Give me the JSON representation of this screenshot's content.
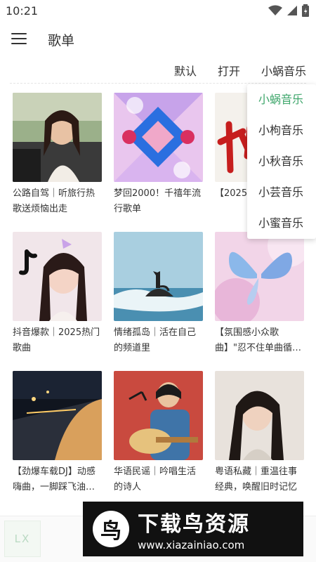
{
  "status": {
    "time": "10:21"
  },
  "app": {
    "title": "歌单"
  },
  "sources": [
    "默认",
    "打开",
    "小蜗音乐"
  ],
  "dropdown": {
    "items": [
      "小蜗音乐",
      "小枸音乐",
      "小秋音乐",
      "小芸音乐",
      "小蜜音乐"
    ],
    "selected_index": 0,
    "accent_color": "#3ea66b"
  },
  "playlists": [
    {
      "title": "公路自驾｜听旅行热歌送烦恼出走",
      "cover_icon": "portrait-woman-car"
    },
    {
      "title": "梦回2000！千禧年流行歌单",
      "cover_icon": "kaleidoscope-art"
    },
    {
      "title": "【2025…秒沦陷…",
      "cover_icon": "red-calligraphy"
    },
    {
      "title": "抖音爆款｜2025热门歌曲",
      "cover_icon": "tiktok-portrait"
    },
    {
      "title": "情绪孤岛｜活在自己的频道里",
      "cover_icon": "cat-on-rock-sea"
    },
    {
      "title": "【氛围感小众歌曲】\"忍不住单曲循…",
      "cover_icon": "butterfly-art"
    },
    {
      "title": "【劲爆车载DJ】动感嗨曲，一脚踩飞油…",
      "cover_icon": "night-car-drive"
    },
    {
      "title": "华语民谣｜吟唱生活的诗人",
      "cover_icon": "guitar-singer-illustration"
    },
    {
      "title": "粤语私藏｜重温往事经典，唤醒旧时记忆",
      "cover_icon": "vintage-portrait"
    }
  ],
  "player": {
    "logo": "LX"
  },
  "watermark": {
    "title": "下载鸟资源",
    "url": "www.xiazainiao.com",
    "glyph": "鸟"
  }
}
